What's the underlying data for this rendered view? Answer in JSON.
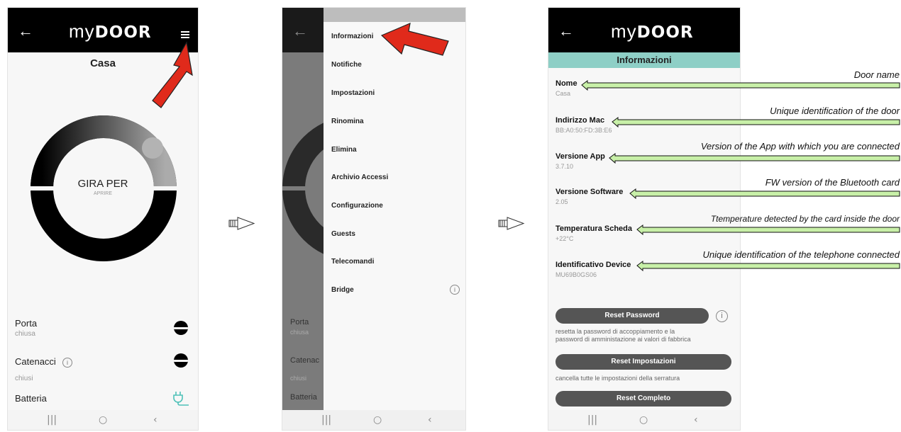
{
  "app": {
    "logo_prefix": "my",
    "logo_main": "DOOR",
    "back_icon": "←",
    "menu_icon": "hamburger-menu-icon"
  },
  "screen1": {
    "title": "Casa",
    "dial_text": "GIRA PER",
    "dial_subtext": "APRIRE",
    "rows": [
      {
        "label": "Porta",
        "value": "chiusa"
      },
      {
        "label": "Catenacci",
        "value": "chiusi"
      },
      {
        "label": "Batteria"
      }
    ],
    "info_glyph": "i"
  },
  "screen2": {
    "menu": [
      "Informazioni",
      "Notifiche",
      "Impostazioni",
      "Rinomina",
      "Elimina",
      "Archivio Accessi",
      "Configurazione",
      "Guests",
      "Telecomandi",
      "Bridge"
    ],
    "behind_rows": [
      {
        "label": "Porta",
        "value": "chiusa"
      },
      {
        "label": "Catenac",
        "value": "chiusi"
      },
      {
        "label": "Batteria"
      }
    ],
    "info_glyph": "i"
  },
  "screen3": {
    "header": "Informazioni",
    "fields": [
      {
        "label": "Nome",
        "value": "Casa"
      },
      {
        "label": "Indirizzo Mac",
        "value": "BB:A0:50:FD:3B:E6"
      },
      {
        "label": "Versione App",
        "value": "3.7.10"
      },
      {
        "label": "Versione Software",
        "value": "2.05"
      },
      {
        "label": "Temperatura Scheda",
        "value": "+22°C"
      },
      {
        "label": "Identificativo Device",
        "value": "MU69B0GS06"
      }
    ],
    "buttons": {
      "reset_password": "Reset Password",
      "reset_password_desc_1": "resetta la password di accoppiamento e la",
      "reset_password_desc_2": "password di amministazione ai valori di fabbrica",
      "reset_settings": "Reset Impostazioni",
      "reset_settings_desc": "cancella tutte le impostazioni della serratura",
      "reset_full": "Reset Completo"
    },
    "info_glyph": "i"
  },
  "annotations": [
    "Door name",
    "Unique identification of the door",
    "Version of the App with which you are connected",
    "FW version of the Bluetooth card",
    "Ttemperature detected by the card inside the door",
    "Unique identification of the telephone connected"
  ],
  "navbar": {
    "recents": "|||",
    "home": "○",
    "back": "‹"
  },
  "colors": {
    "accent_teal": "#8ecfc6",
    "red_arrow": "#e02a1b",
    "annotation_arrow": "#c8f0a8",
    "dark_button": "#555555"
  }
}
